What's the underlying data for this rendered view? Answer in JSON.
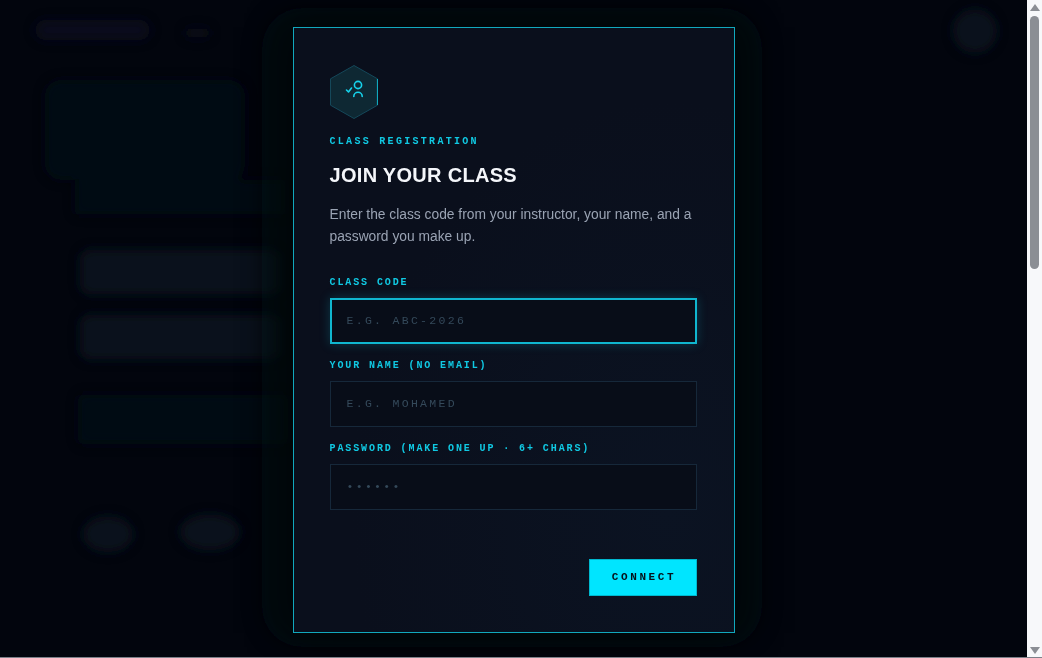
{
  "dialog": {
    "eyebrow": "CLASS REGISTRATION",
    "title": "JOIN YOUR CLASS",
    "description": "Enter the class code from your instructor, your name, and a password you make up.",
    "fields": [
      {
        "label": "CLASS CODE",
        "placeholder": "E.G. ABC-2026",
        "focused": true
      },
      {
        "label": "YOUR NAME (NO EMAIL)",
        "placeholder": "E.G. MOHAMED",
        "focused": false
      },
      {
        "label": "PASSWORD (MAKE ONE UP · 6+ CHARS)",
        "placeholder": "••••••",
        "focused": false
      }
    ],
    "submit_button": "CONNECT"
  }
}
